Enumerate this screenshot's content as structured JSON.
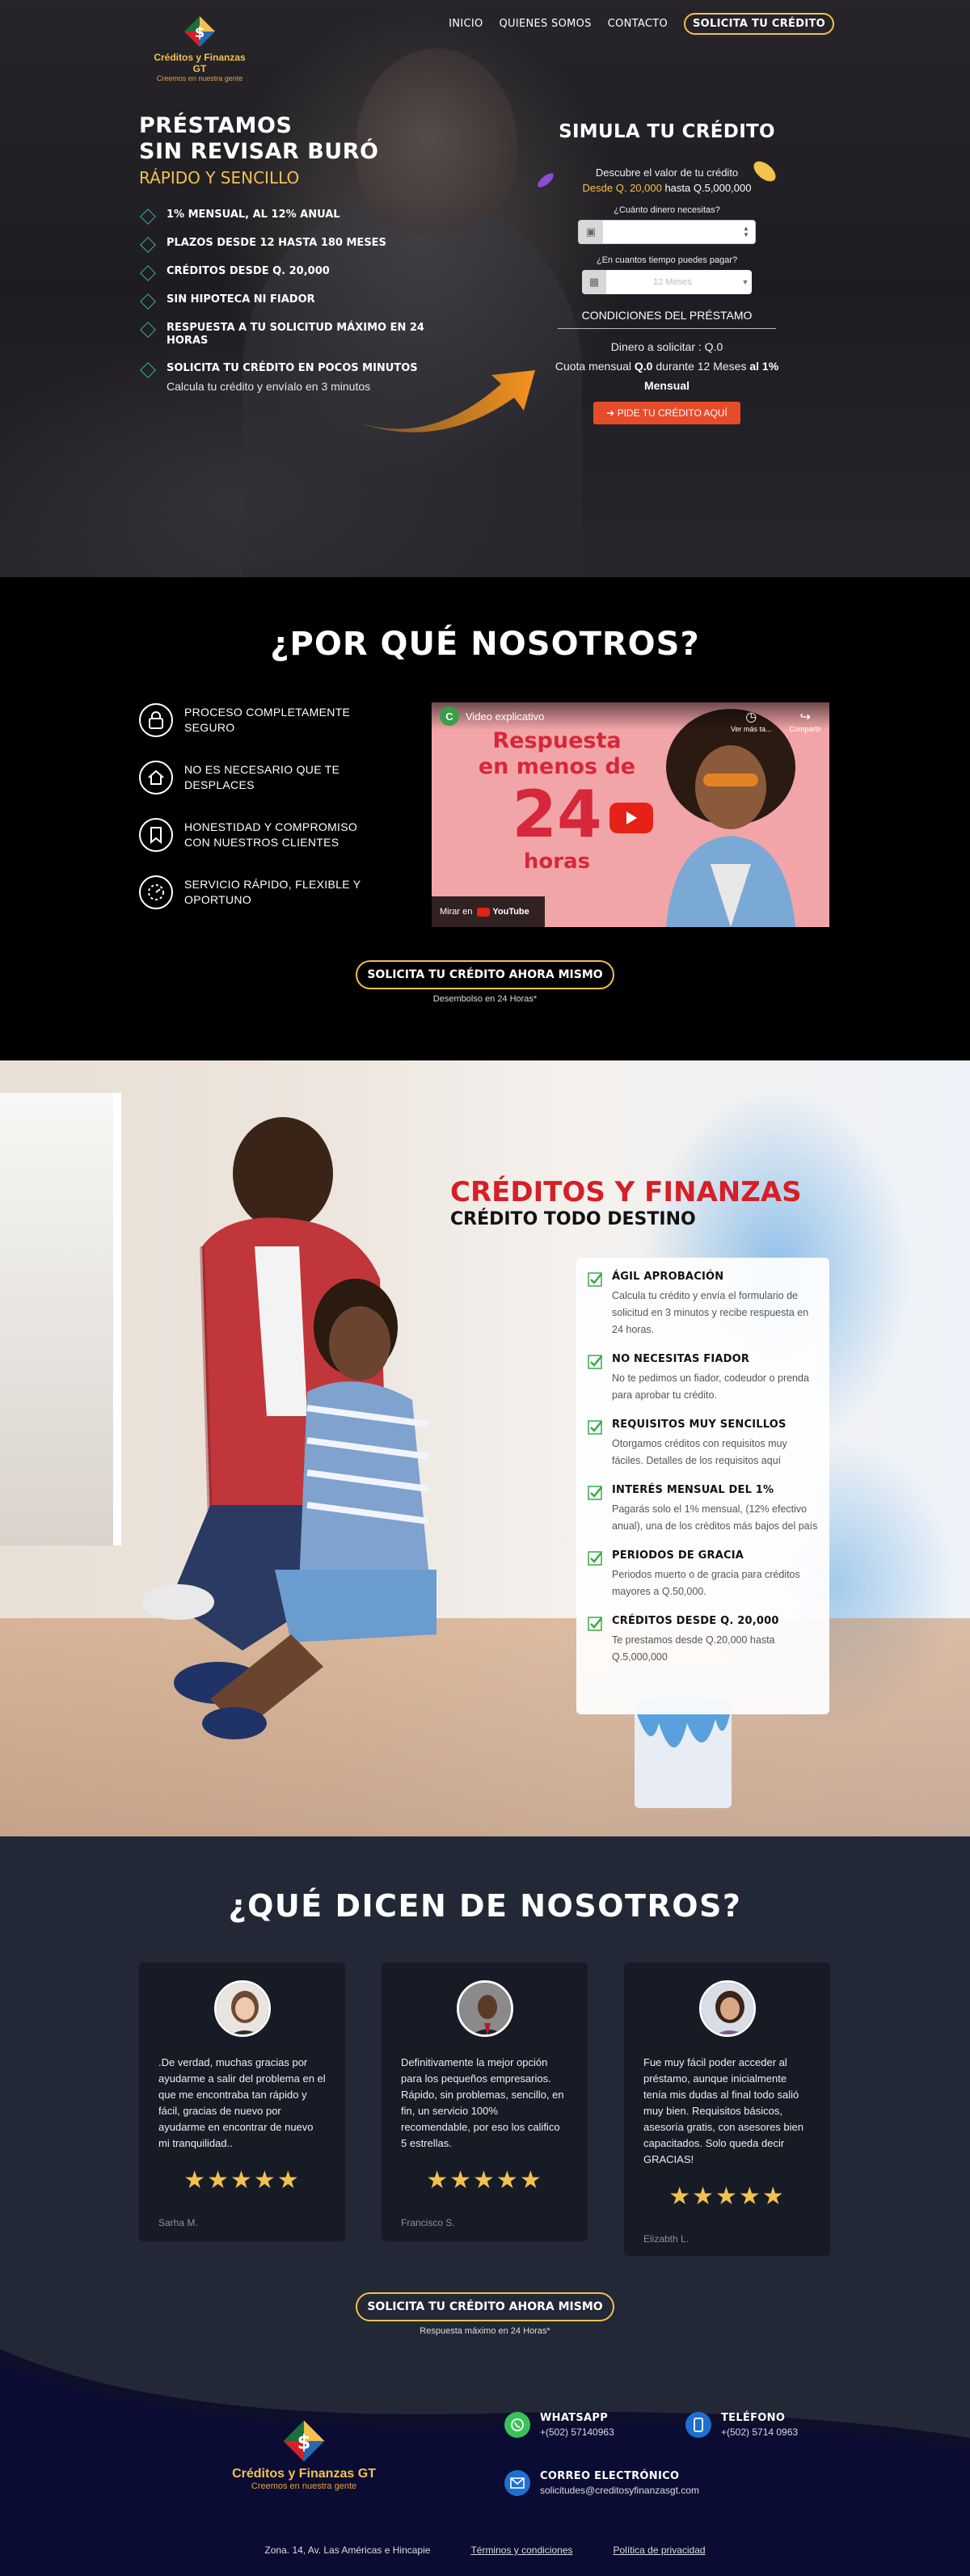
{
  "brand": {
    "name": "Créditos y Finanzas GT",
    "tagline": "Creemos en nuestra gente"
  },
  "nav": {
    "items": [
      "INICIO",
      "QUIENES SOMOS",
      "CONTACTO"
    ],
    "cta": "SOLICITA TU CRÉDITO"
  },
  "hero": {
    "title_line1": "PRÉSTAMOS",
    "title_line2": "SIN REVISAR BURÓ",
    "subtitle": "RÁPIDO Y SENCILLO",
    "bullets": [
      "1% MENSUAL, AL 12% ANUAL",
      "PLAZOS DESDE 12 HASTA 180 MESES",
      "CRÉDITOS DESDE Q. 20,000",
      "SIN HIPOTECA NI FIADOR",
      "RESPUESTA A TU SOLICITUD MÁXIMO EN 24 HORAS",
      "SOLICITA TU CRÉDITO EN POCOS MINUTOS"
    ],
    "bullet_last_sub": "Calcula tu crédito y envíalo en 3 minutos"
  },
  "simulator": {
    "title": "SIMULA TU CRÉDITO",
    "desc": "Descubre el valor de tu crédito",
    "range_from": "Desde Q. 20,000",
    "range_rest": " hasta Q.5,000,000",
    "q_amount": "¿Cuánto dinero necesitas?",
    "amount_value": "",
    "q_time": "¿En cuantos tiempo puedes pagar?",
    "time_value": "12 Meses",
    "conditions_title": "CONDICIONES DEL PRÉSTAMO",
    "out_line1_label": "Dinero a solicitar :",
    "out_line1_value": "Q.0",
    "out_line2_label": "Cuota mensual",
    "out_line2_value": "Q.0",
    "out_line2_mid": "durante",
    "out_line2_months": "12 Meses",
    "out_line2_rate": "al 1%",
    "out_line3": "Mensual",
    "button": "PIDE TU CRÉDITO AQUÍ"
  },
  "why": {
    "title": "¿POR QUÉ NOSOTROS?",
    "items": [
      {
        "text": "PROCESO COMPLETAMENTE SEGURO",
        "icon": "lock-icon"
      },
      {
        "text": "NO ES NECESARIO QUE TE DESPLACES",
        "icon": "home-icon"
      },
      {
        "text": "HONESTIDAD Y COMPROMISO CON NUESTROS CLIENTES",
        "icon": "bookmark-icon"
      },
      {
        "text": "SERVICIO RÁPIDO, FLEXIBLE Y OPORTUNO",
        "icon": "speed-icon"
      }
    ],
    "video": {
      "channel_letter": "C",
      "title": "Video explicativo",
      "headline1": "Respuesta",
      "headline2": "en menos de",
      "headline3": "24",
      "headline4": "horas",
      "watch_later": "Ver más ta...",
      "share": "Compartir",
      "watch_on": "Mirar en",
      "youtube": "YouTube"
    },
    "cta": "SOLICITA TU CRÉDITO AHORA MISMO",
    "cta_sub": "Desembolso en 24 Horas*"
  },
  "credits": {
    "title": "CRÉDITOS Y FINANZAS",
    "subtitle": "CRÉDITO TODO DESTINO",
    "features": [
      {
        "title": "ÁGIL APROBACIÓN",
        "desc": "Calcula tu crédito y envía el formulario de solicitud en 3 minutos y recibe respuesta en 24 horas."
      },
      {
        "title": "NO NECESITAS FIADOR",
        "desc": "No te pedimos un fiador, codeudor o prenda para aprobar tu crédito."
      },
      {
        "title": "REQUISITOS MUY SENCILLOS",
        "desc": "Otorgamos créditos con requisitos muy fáciles. Detalles de los requisitos aquí"
      },
      {
        "title": "INTERÉS MENSUAL DEL 1%",
        "desc": "Pagarás solo el 1% mensual, (12% efectivo anual), una de los créditos más bajos del país"
      },
      {
        "title": "PERIODOS DE GRACIA",
        "desc": "Periodos muerto o de gracia para créditos mayores a Q.50,000."
      },
      {
        "title": "CRÉDITOS DESDE Q. 20,000",
        "desc": "Te prestamos desde Q.20,000 hasta Q.5,000,000"
      }
    ]
  },
  "testimonials": {
    "title": "¿QUÉ DICEN DE NOSOTROS?",
    "items": [
      {
        "quote": ".De verdad, muchas gracias por ayudarme a salir del problema en el que me encontraba tan rápido y fácil, gracias de nuevo por ayudarme en encontrar de nuevo mi tranquilidad..",
        "stars": "★★★★★",
        "rating": 5,
        "name": "Sarha M."
      },
      {
        "quote": "Definitivamente la mejor opción para los pequeños empresarios. Rápido, sin problemas, sencillo, en fin, un servicio 100% recomendable, por eso los califico 5 estrellas.",
        "stars": "★★★★★",
        "rating": 5,
        "name": "Francisco S."
      },
      {
        "quote": "Fue muy fácil poder acceder al préstamo, aunque inicialmente tenía mis dudas al final todo salió muy bien. Requisitos básicos, asesoría gratis, con asesores bien capacitados. Solo queda decir GRACIAS!",
        "stars": "★★★★★",
        "rating": 5,
        "name": "Elizabth L."
      }
    ],
    "cta": "SOLICITA TU CRÉDITO AHORA MISMO",
    "cta_sub": "Respuesta máximo en 24 Horas*"
  },
  "footer": {
    "whatsapp_title": "WHATSAPP",
    "whatsapp_value": "+(502) 57140963",
    "phone_title": "TELÉFONO",
    "phone_value": "+(502) 5714 0963",
    "email_title": "CORREO ELECTRÓNICO",
    "email_value": "solicitudes@creditosyfinanzasgt.com",
    "address": "Zona. 14, Av. Las Américas e Hincapie",
    "terms": "Términos y condiciones",
    "privacy": "Política de privacidad"
  },
  "colors": {
    "gold": "#f2c14e",
    "red": "#d61f26",
    "cta_orange": "#e74c2a",
    "teal": "#38b1a3",
    "navy": "#232837"
  }
}
